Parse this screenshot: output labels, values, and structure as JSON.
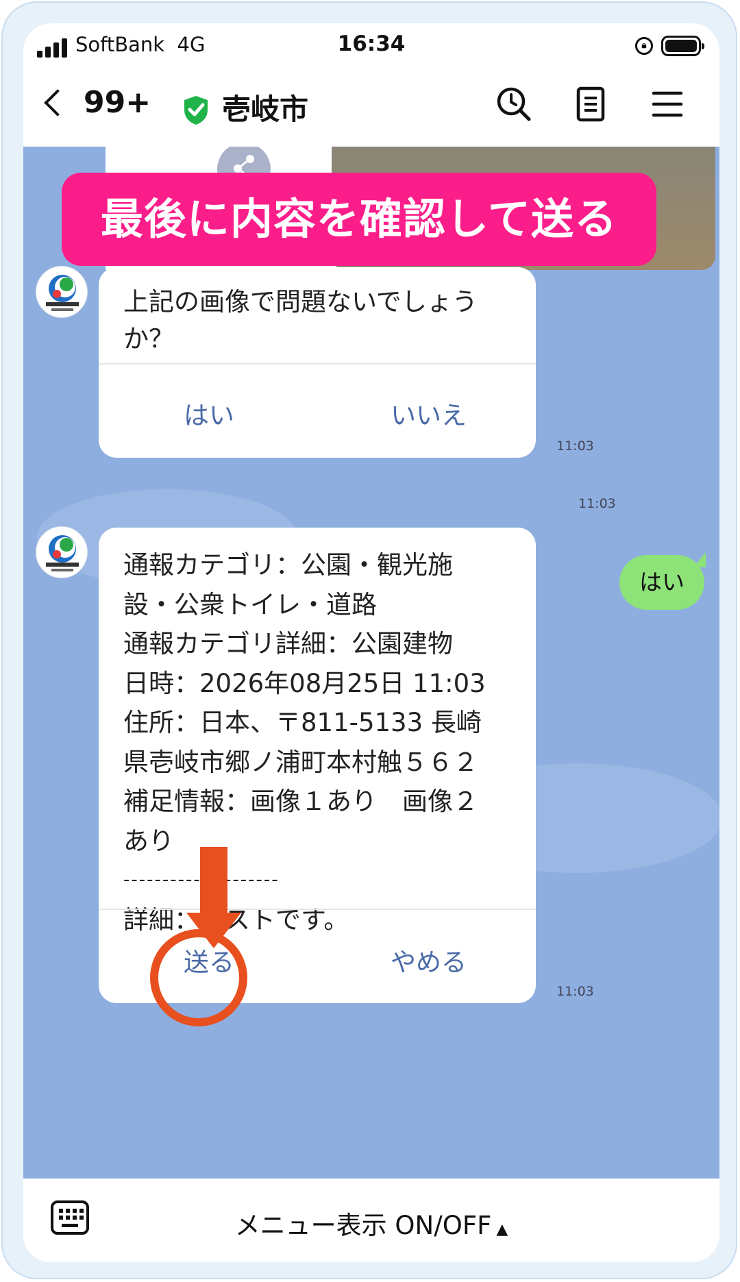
{
  "status_bar": {
    "carrier": "SoftBank",
    "network": "4G",
    "time": "16:34"
  },
  "header": {
    "back_count": "99+",
    "title": "壱岐市",
    "icons": [
      "search-icon",
      "notes-icon",
      "menu-icon"
    ]
  },
  "banner": {
    "text": "最後に内容を確認して送る"
  },
  "messages": [
    {
      "text": "上記の画像で問題ないでしょうか？",
      "choice_yes": "はい",
      "choice_no": "いいえ",
      "time": "11:03"
    },
    {
      "user_text": "はい",
      "time": "11:03"
    },
    {
      "lines": [
        "通報カテゴリ：公園・観光施",
        "設・公衆トイレ・道路",
        "通報カテゴリ詳細：公園建物",
        "日時：2026年08月25日 11:03",
        "住所：日本、〒811-5133 長崎",
        "県壱岐市郷ノ浦町本村触５６２",
        "補足情報：画像１あり　画像２",
        "あり",
        "--------------------",
        "詳細：テストです。"
      ],
      "choice_send": "送る",
      "choice_cancel": "やめる",
      "time": "11:03"
    }
  ],
  "footer": {
    "menu_toggle": "メニュー表示 ON/OFF"
  },
  "colors": {
    "banner": "#fb1e8a",
    "arrow": "#e8501f",
    "chat_bg": "#8eaee0",
    "user_bubble": "#8de278",
    "link": "#4a6ba7"
  }
}
